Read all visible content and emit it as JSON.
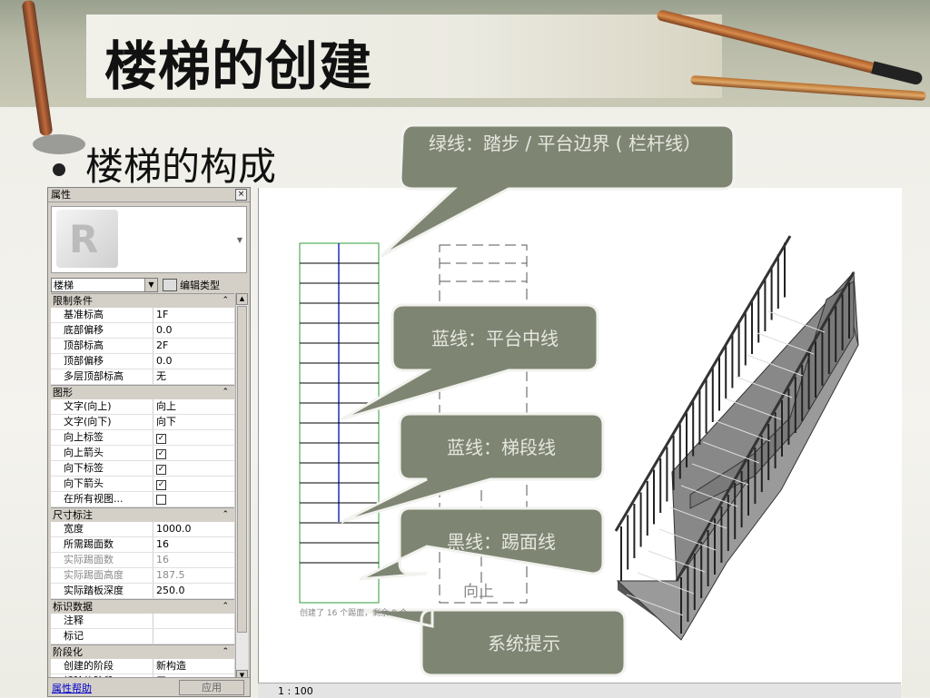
{
  "slide": {
    "title": "楼梯的创建",
    "bullet": "楼梯的构成"
  },
  "properties_panel": {
    "header": "属性",
    "close": "×",
    "type_value": "楼梯",
    "edit_type": "编辑类型",
    "groups": [
      {
        "label": "限制条件",
        "toggle": "⌃",
        "rows": [
          {
            "key": "基准标高",
            "value": "1F"
          },
          {
            "key": "底部偏移",
            "value": "0.0"
          },
          {
            "key": "顶部标高",
            "value": "2F"
          },
          {
            "key": "顶部偏移",
            "value": "0.0"
          },
          {
            "key": "多层顶部标高",
            "value": "无"
          }
        ]
      },
      {
        "label": "图形",
        "toggle": "⌃",
        "rows": [
          {
            "key": "文字(向上)",
            "value": "向上"
          },
          {
            "key": "文字(向下)",
            "value": "向下"
          },
          {
            "key": "向上标签",
            "check": true
          },
          {
            "key": "向上箭头",
            "check": true
          },
          {
            "key": "向下标签",
            "check": true
          },
          {
            "key": "向下箭头",
            "check": true
          },
          {
            "key": "在所有视图...",
            "check": false
          }
        ]
      },
      {
        "label": "尺寸标注",
        "toggle": "⌃",
        "rows": [
          {
            "key": "宽度",
            "value": "1000.0"
          },
          {
            "key": "所需踢面数",
            "value": "16"
          },
          {
            "key": "实际踢面数",
            "value": "16",
            "dim": true
          },
          {
            "key": "实际踢面高度",
            "value": "187.5",
            "dim": true
          },
          {
            "key": "实际踏板深度",
            "value": "250.0"
          }
        ]
      },
      {
        "label": "标识数据",
        "toggle": "⌃",
        "rows": [
          {
            "key": "注释",
            "value": ""
          },
          {
            "key": "标记",
            "value": ""
          }
        ]
      },
      {
        "label": "阶段化",
        "toggle": "⌃",
        "rows": [
          {
            "key": "创建的阶段",
            "value": "新构造"
          },
          {
            "key": "拆除的阶段",
            "value": "无"
          }
        ]
      }
    ],
    "help_link": "属性帮助",
    "apply_button": "应用"
  },
  "drawing": {
    "up_label": "向上",
    "status_hint": "创建了 16 个踢面，剩余 0 个",
    "scale": "1 : 100"
  },
  "callouts": [
    {
      "id": "green",
      "text": "绿线：踏步 / 平台边界 ( 栏杆线）"
    },
    {
      "id": "blue-landing",
      "text": "蓝线：平台中线"
    },
    {
      "id": "blue-run",
      "text": "蓝线：梯段线"
    },
    {
      "id": "black",
      "text": "黑线：踢面线"
    },
    {
      "id": "system",
      "text": "系统提示"
    }
  ],
  "colors": {
    "callout_fill": "#7e8673",
    "callout_stroke": "#f2f2ee",
    "boundary_green": "#2e9e38",
    "run_blue": "#1a2fb8",
    "riser_black": "#000000"
  }
}
